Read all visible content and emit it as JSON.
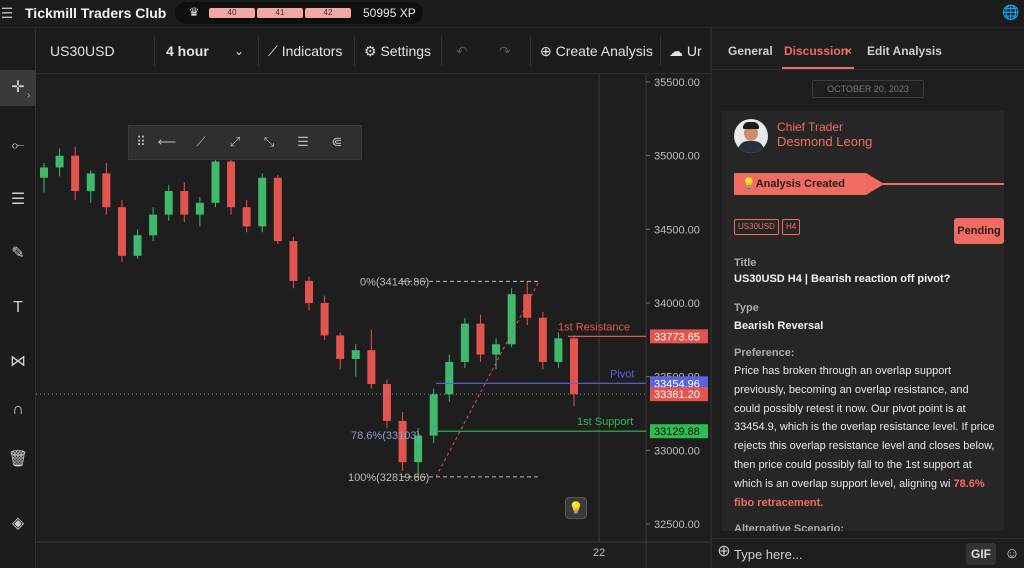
{
  "app": {
    "title": "Tickmill Traders Club",
    "xp_segments": [
      "40",
      "41",
      "42"
    ],
    "xp_total": "50995 XP"
  },
  "toolbar": {
    "symbol": "US30USD",
    "timeframe": "4 hour",
    "indicators_label": "Indicators",
    "settings_label": "Settings",
    "create_analysis_label": "Create Analysis",
    "upload_label": "Ur"
  },
  "chart_data": {
    "type": "candlestick",
    "price_axis_ticks": [
      "35500.00",
      "35000.00",
      "34500.00",
      "34000.00",
      "33500.00",
      "33000.00",
      "32500.00"
    ],
    "x_tick": "22",
    "y_range": [
      32500,
      35500
    ],
    "series": [
      {
        "t": 0,
        "o": 34850,
        "h": 34950,
        "l": 34750,
        "c": 34920
      },
      {
        "t": 1,
        "o": 34920,
        "h": 35050,
        "l": 34860,
        "c": 35000
      },
      {
        "t": 2,
        "o": 35000,
        "h": 35060,
        "l": 34700,
        "c": 34760
      },
      {
        "t": 3,
        "o": 34760,
        "h": 34900,
        "l": 34680,
        "c": 34880
      },
      {
        "t": 4,
        "o": 34880,
        "h": 34950,
        "l": 34600,
        "c": 34650
      },
      {
        "t": 5,
        "o": 34650,
        "h": 34700,
        "l": 34280,
        "c": 34320
      },
      {
        "t": 6,
        "o": 34320,
        "h": 34500,
        "l": 34300,
        "c": 34460
      },
      {
        "t": 7,
        "o": 34460,
        "h": 34650,
        "l": 34420,
        "c": 34600
      },
      {
        "t": 8,
        "o": 34600,
        "h": 34800,
        "l": 34560,
        "c": 34760
      },
      {
        "t": 9,
        "o": 34760,
        "h": 34820,
        "l": 34550,
        "c": 34600
      },
      {
        "t": 10,
        "o": 34600,
        "h": 34720,
        "l": 34520,
        "c": 34680
      },
      {
        "t": 11,
        "o": 34680,
        "h": 35000,
        "l": 34650,
        "c": 34960
      },
      {
        "t": 12,
        "o": 34960,
        "h": 35000,
        "l": 34600,
        "c": 34650
      },
      {
        "t": 13,
        "o": 34650,
        "h": 34700,
        "l": 34480,
        "c": 34520
      },
      {
        "t": 14,
        "o": 34520,
        "h": 34880,
        "l": 34480,
        "c": 34850
      },
      {
        "t": 15,
        "o": 34850,
        "h": 34870,
        "l": 34400,
        "c": 34420
      },
      {
        "t": 16,
        "o": 34420,
        "h": 34450,
        "l": 34100,
        "c": 34150
      },
      {
        "t": 17,
        "o": 34150,
        "h": 34180,
        "l": 33950,
        "c": 34000
      },
      {
        "t": 18,
        "o": 34000,
        "h": 34050,
        "l": 33750,
        "c": 33780
      },
      {
        "t": 19,
        "o": 33780,
        "h": 33800,
        "l": 33550,
        "c": 33620
      },
      {
        "t": 20,
        "o": 33620,
        "h": 33720,
        "l": 33500,
        "c": 33680
      },
      {
        "t": 21,
        "o": 33680,
        "h": 33820,
        "l": 33420,
        "c": 33450
      },
      {
        "t": 22,
        "o": 33450,
        "h": 33480,
        "l": 33150,
        "c": 33200
      },
      {
        "t": 23,
        "o": 33200,
        "h": 33260,
        "l": 32860,
        "c": 32920
      },
      {
        "t": 24,
        "o": 32920,
        "h": 33150,
        "l": 32820,
        "c": 33100
      },
      {
        "t": 25,
        "o": 33100,
        "h": 33420,
        "l": 33050,
        "c": 33380
      },
      {
        "t": 26,
        "o": 33380,
        "h": 33650,
        "l": 33330,
        "c": 33600
      },
      {
        "t": 27,
        "o": 33600,
        "h": 33900,
        "l": 33560,
        "c": 33860
      },
      {
        "t": 28,
        "o": 33860,
        "h": 33920,
        "l": 33600,
        "c": 33650
      },
      {
        "t": 29,
        "o": 33650,
        "h": 33760,
        "l": 33550,
        "c": 33720
      },
      {
        "t": 30,
        "o": 33720,
        "h": 34100,
        "l": 33700,
        "c": 34060
      },
      {
        "t": 31,
        "o": 34060,
        "h": 34147,
        "l": 33850,
        "c": 33900
      },
      {
        "t": 32,
        "o": 33900,
        "h": 33940,
        "l": 33550,
        "c": 33600
      },
      {
        "t": 33,
        "o": 33600,
        "h": 33800,
        "l": 33560,
        "c": 33760
      },
      {
        "t": 34,
        "o": 33760,
        "h": 33780,
        "l": 33300,
        "c": 33381
      }
    ],
    "annotations": {
      "fib_0": "0%(34146.86)",
      "fib_786": "78.6%(33103)",
      "fib_100": "100%(32819.66)",
      "resistance_label": "1st Resistance",
      "pivot_label": "Pivot",
      "support_label": "1st Support",
      "resistance_price": "33773.65",
      "pivot_price": "33454.96",
      "last_price": "33381.20",
      "support_price": "33129.88",
      "fib_high": 34146.86,
      "fib_low": 32819.66,
      "fib_786_level": 33103,
      "resistance": 33773.65,
      "pivot": 33454.96,
      "support": 33129.88,
      "last": 33381.2
    }
  },
  "panel": {
    "tabs": [
      "General",
      "Discussion",
      "Edit Analysis"
    ],
    "tab_close": "×",
    "date": "OCTOBER 20, 2023",
    "author_role": "Chief Trader",
    "author_name": "Desmond Leong",
    "status_ribbon": "Analysis Created",
    "tags": [
      "US30USD",
      "H4"
    ],
    "status": "Pending",
    "title_label": "Title",
    "title_value": "US30USD H4 | Bearish reaction off pivot?",
    "type_label": "Type",
    "type_value": "Bearish Reversal",
    "preference_label": "Preference:",
    "preference_text": "Price has broken through an overlap support previously, becoming an overlap resistance, and could possibly retest it now. Our pivot point is at 33454.9, which is the overlap resistance level. If price rejects this overlap resistance level and closes below, then price could possibly fall to the 1st support at ",
    "preference_text_tail": "which is an overlap support level, aligning wi",
    "preference_highlight": "78.6% fibo retracement.",
    "alt_label": "Alternative Scenario:"
  },
  "composer": {
    "placeholder": "Type here...",
    "gif_label": "GIF"
  }
}
